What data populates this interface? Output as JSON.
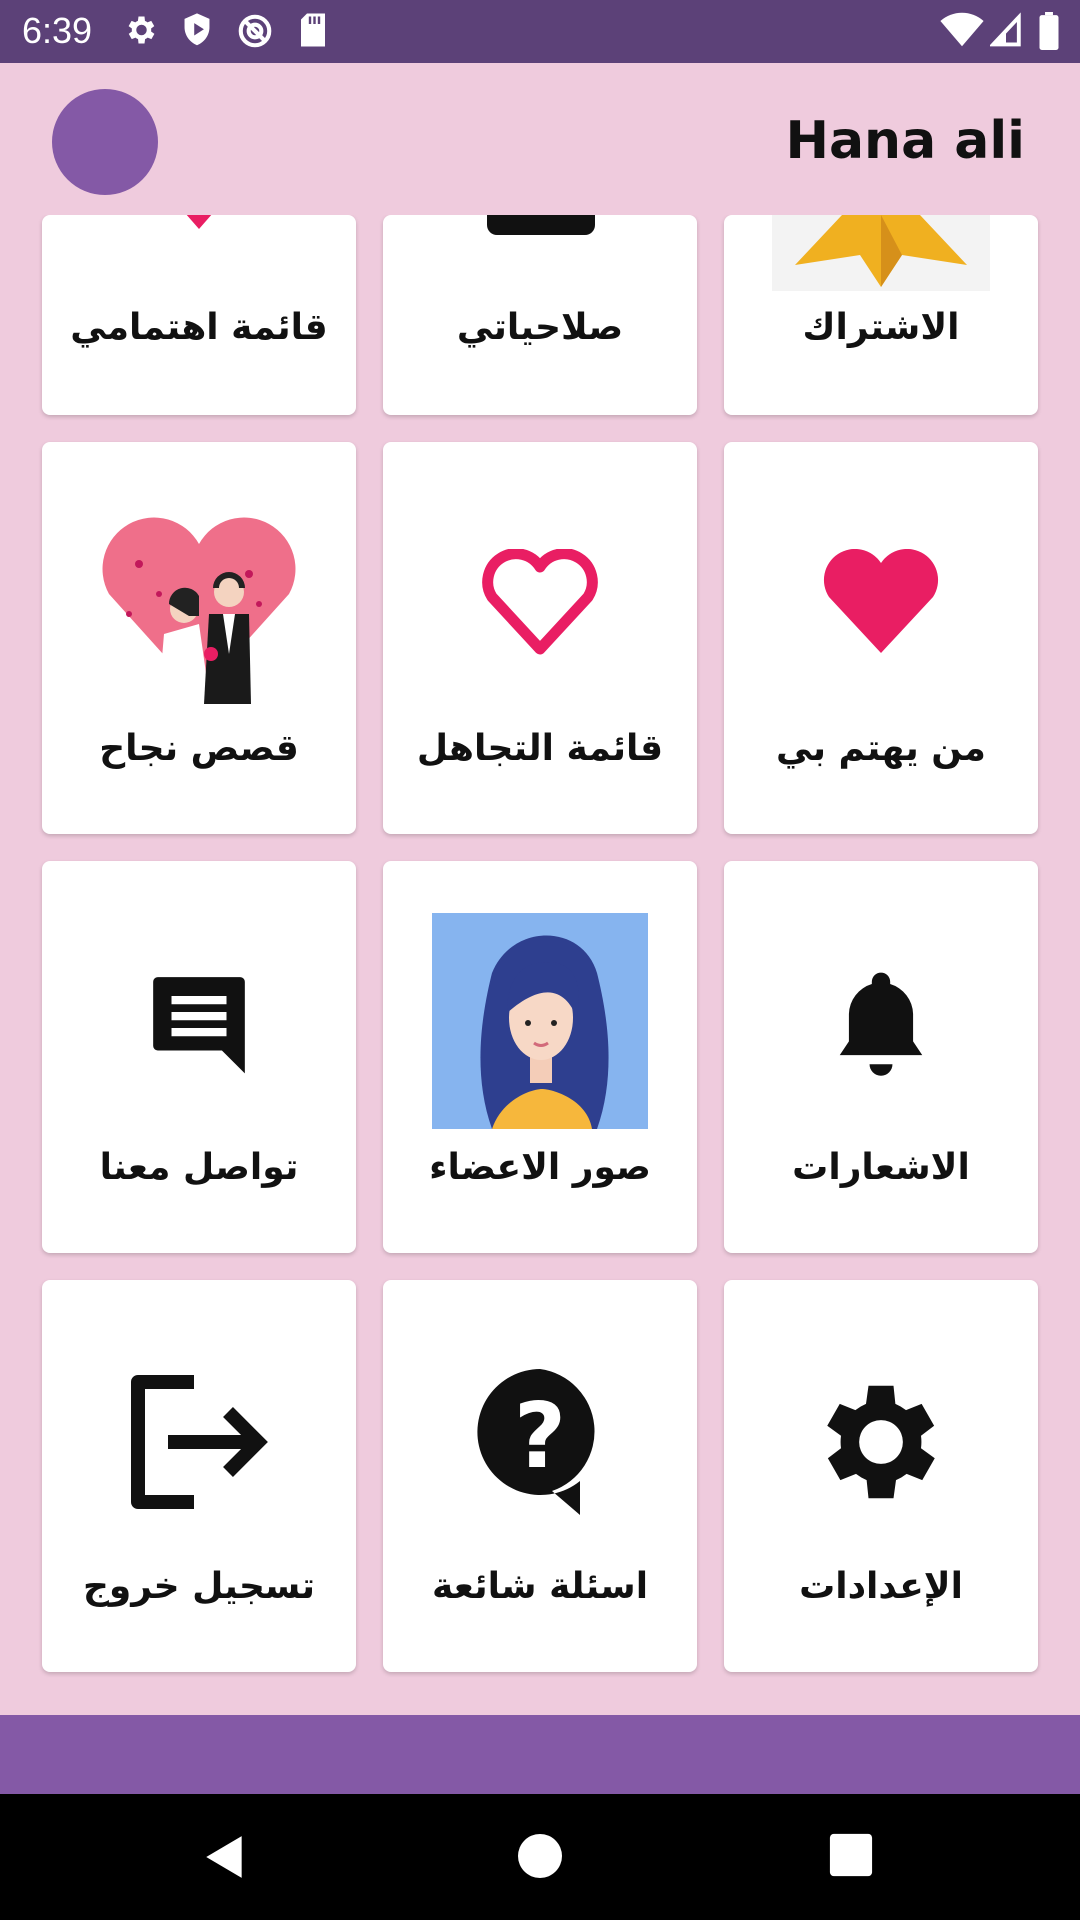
{
  "status_bar": {
    "time": "6:39"
  },
  "header": {
    "title": "Hana ali"
  },
  "menu": {
    "row1": [
      "قائمة اهتمامي",
      "صلاحياتي",
      "الاشتراك"
    ],
    "row2": [
      "قصص نجاح",
      "قائمة التجاهل",
      "من يهتم بي"
    ],
    "row3": [
      "تواصل معنا",
      "صور الاعضاء",
      "الاشعارات"
    ],
    "row4": [
      "تسجيل خروج",
      "اسئلة شائعة",
      "الإعدادات"
    ]
  },
  "colors": {
    "status_bar": "#5c4178",
    "background": "#efcbdd",
    "accent": "#8459a6",
    "heart": "#e91e63"
  },
  "icons": {
    "row1": [
      "heart-icon",
      "briefcase-icon",
      "star-icon"
    ],
    "row2": [
      "wedding-couple-icon",
      "heart-outline-icon",
      "heart-filled-icon"
    ],
    "row3": [
      "chat-icon",
      "woman-avatar-icon",
      "bell-icon"
    ],
    "row4": [
      "logout-icon",
      "help-icon",
      "gear-icon"
    ]
  }
}
